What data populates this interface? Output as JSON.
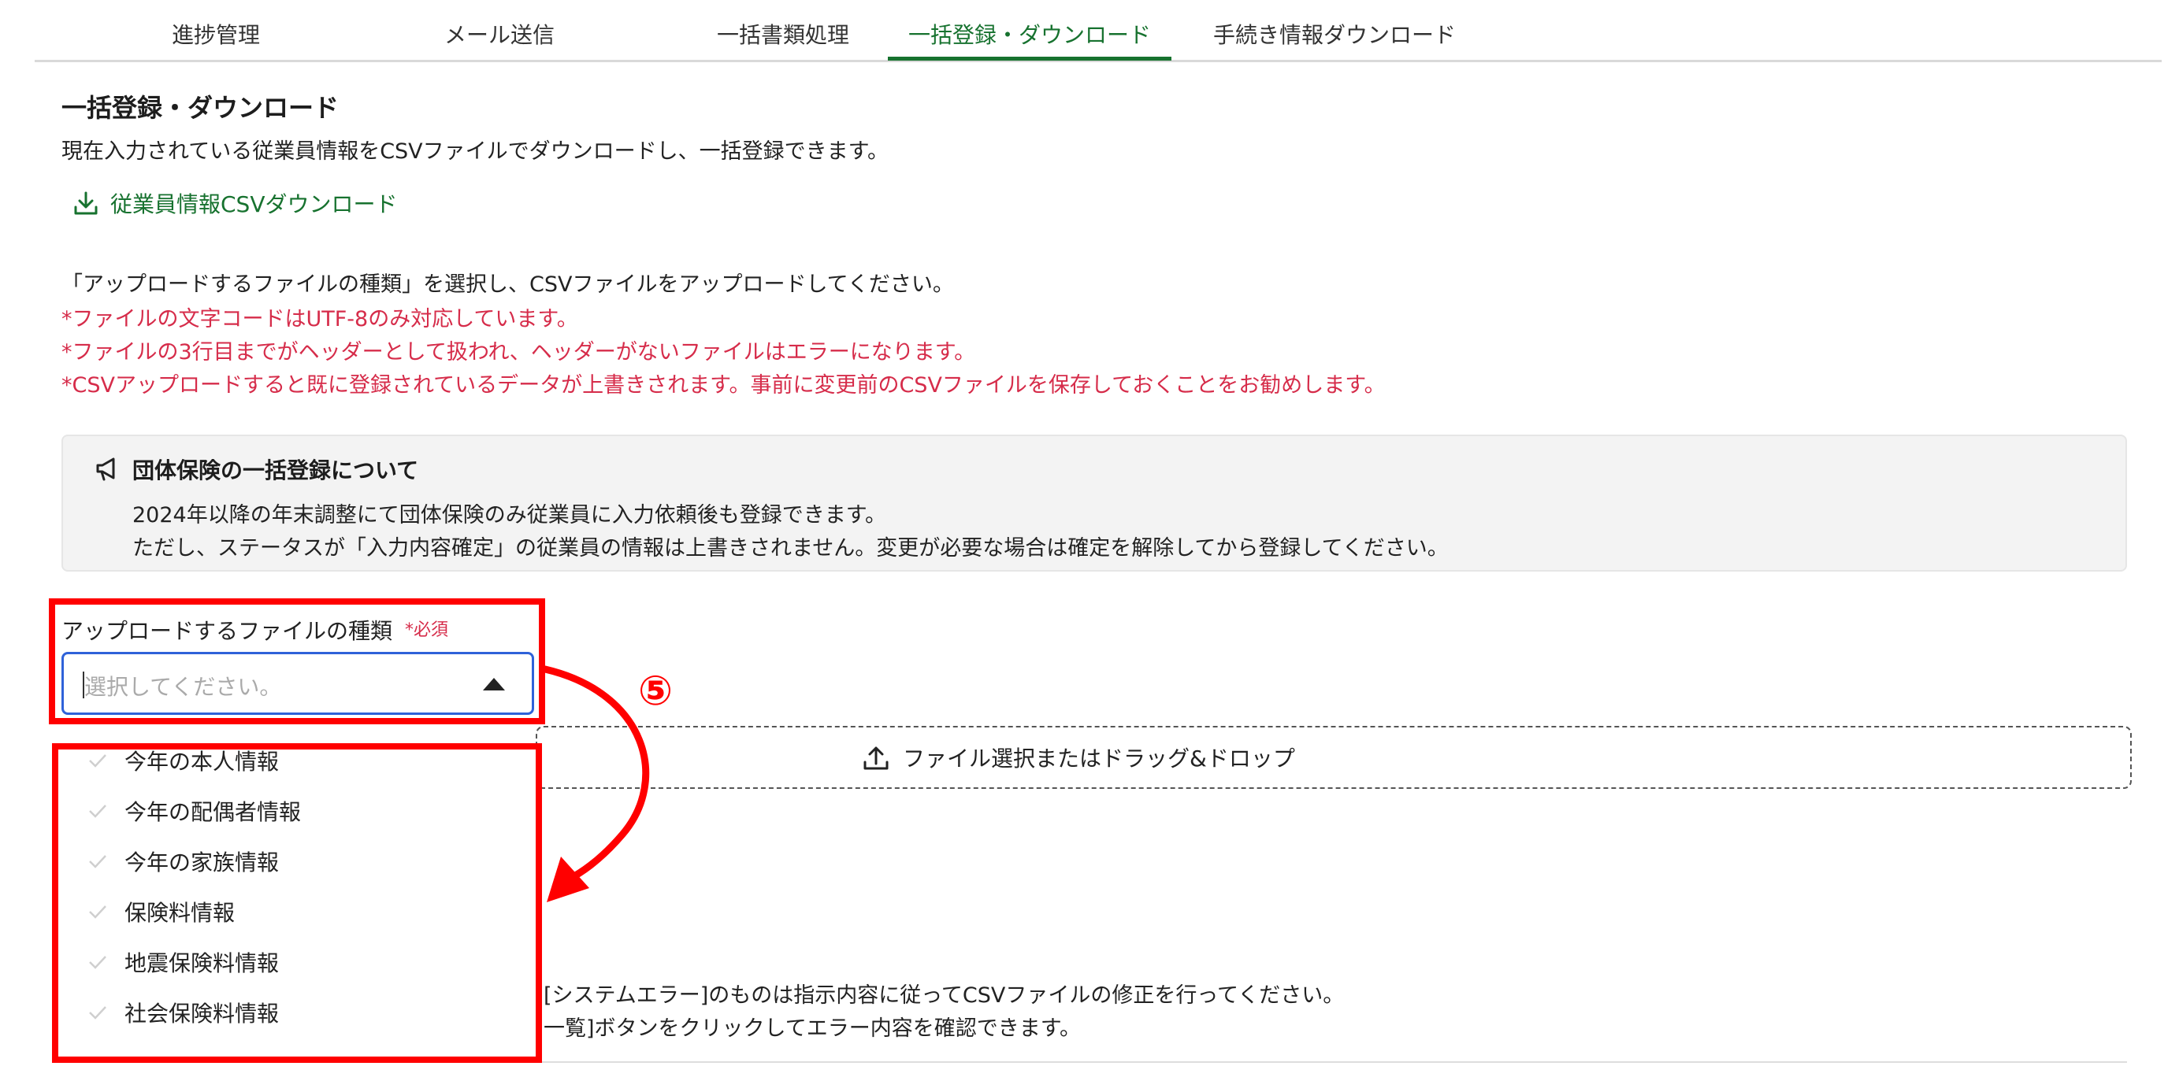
{
  "tabs": [
    {
      "label": "進捗管理"
    },
    {
      "label": "メール送信"
    },
    {
      "label": "一括書類処理"
    },
    {
      "label": "一括登録・ダウンロード"
    },
    {
      "label": "手続き情報ダウンロード"
    }
  ],
  "active_tab": "一括登録・ダウンロード",
  "page": {
    "title": "一括登録・ダウンロード",
    "description": "現在入力されている従業員情報をCSVファイルでダウンロードし、一括登録できます。",
    "download_link": "従業員情報CSVダウンロード",
    "instruction": "「アップロードするファイルの種類」を選択し、CSVファイルをアップロードしてください。",
    "warnings": [
      "*ファイルの文字コードはUTF-8のみ対応しています。",
      "*ファイルの3行目までがヘッダーとして扱われ、ヘッダーがないファイルはエラーになります。",
      "*CSVアップロードすると既に登録されているデータが上書きされます。事前に変更前のCSVファイルを保存しておくことをお勧めします。"
    ]
  },
  "notice": {
    "title": "団体保険の一括登録について",
    "lines": [
      "2024年以降の年末調整にて団体保険のみ従業員に入力依頼後も登録できます。",
      "ただし、ステータスが「入力内容確定」の従業員の情報は上書きされません。変更が必要な場合は確定を解除してから登録してください。"
    ]
  },
  "file_type": {
    "label": "アップロードするファイルの種類",
    "required": "*必須",
    "placeholder": "選択してください。",
    "options": [
      "今年の本人情報",
      "今年の配偶者情報",
      "今年の家族情報",
      "保険料情報",
      "地震保険料情報",
      "社会保険料情報"
    ]
  },
  "dropzone": {
    "label": "ファイル選択またはドラッグ&ドロップ"
  },
  "errors_partial": [
    "[システムエラー]のものは指示内容に従ってCSVファイルの修正を行ってください。",
    "一覧]ボタンをクリックしてエラー内容を確認できます。"
  ],
  "annotation": {
    "step": "⑤"
  },
  "colors": {
    "accent": "#17722f",
    "warning": "#d62c4a",
    "focus": "#2f62d9",
    "annotation": "#ff0000"
  },
  "icons": [
    "download-icon",
    "megaphone-icon",
    "upload-icon",
    "check-icon",
    "chevron-up-icon"
  ]
}
